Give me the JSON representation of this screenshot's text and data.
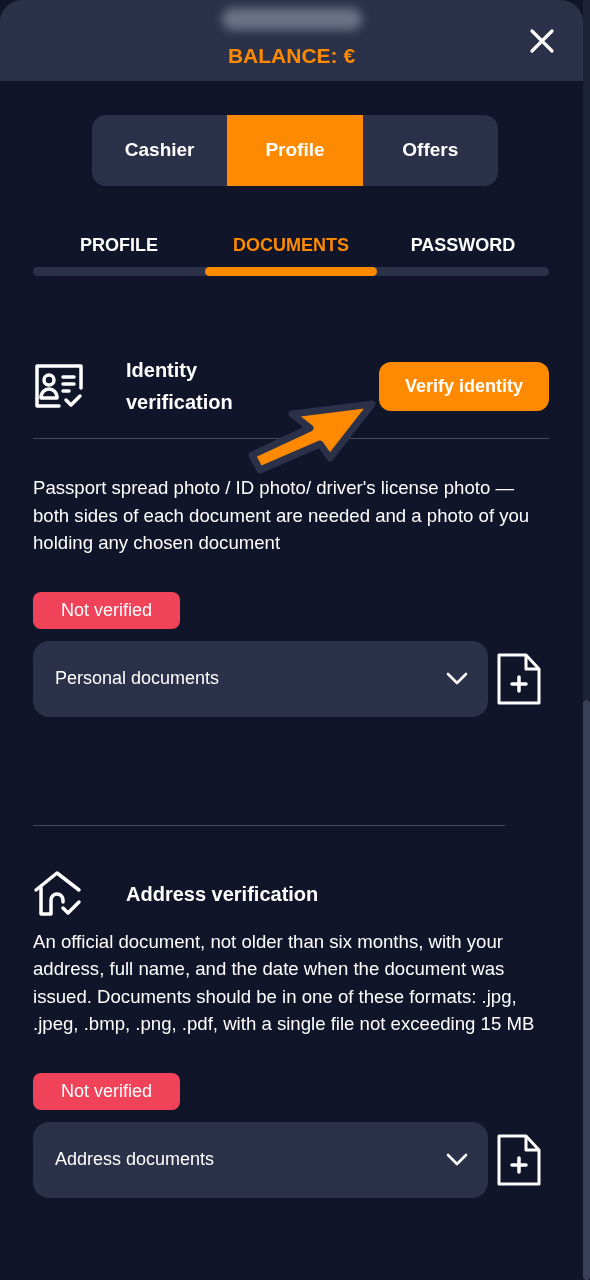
{
  "header": {
    "balance": "BALANCE: €"
  },
  "nav_buttons": [
    {
      "label": "Cashier",
      "selected": false
    },
    {
      "label": "Profile",
      "selected": true
    },
    {
      "label": "Offers",
      "selected": false
    }
  ],
  "tabs": [
    {
      "label": "PROFILE",
      "selected": false
    },
    {
      "label": "DOCUMENTS",
      "selected": true
    },
    {
      "label": "PASSWORD",
      "selected": false
    }
  ],
  "sections": [
    {
      "kind": "identity",
      "title": "Identity verification",
      "action_button": "Verify identity",
      "description": "Passport spread photo / ID photo/ driver's license photo — both sides of each document are needed and a photo of you holding any chosen document",
      "verified": false,
      "status": "Not verified",
      "dropdown": {
        "value": "Personal documents"
      }
    },
    {
      "kind": "address",
      "title": "Address verification",
      "description": "An official document, not older than six months, with your address, full name, and the date when the document was issued. Documents should be in one of these formats: .jpg, .jpeg, .bmp, .png, .pdf, with a single file not exceeding 15 MB",
      "verified": false,
      "status": "Not verified",
      "dropdown": {
        "value": "Address documents"
      }
    }
  ]
}
